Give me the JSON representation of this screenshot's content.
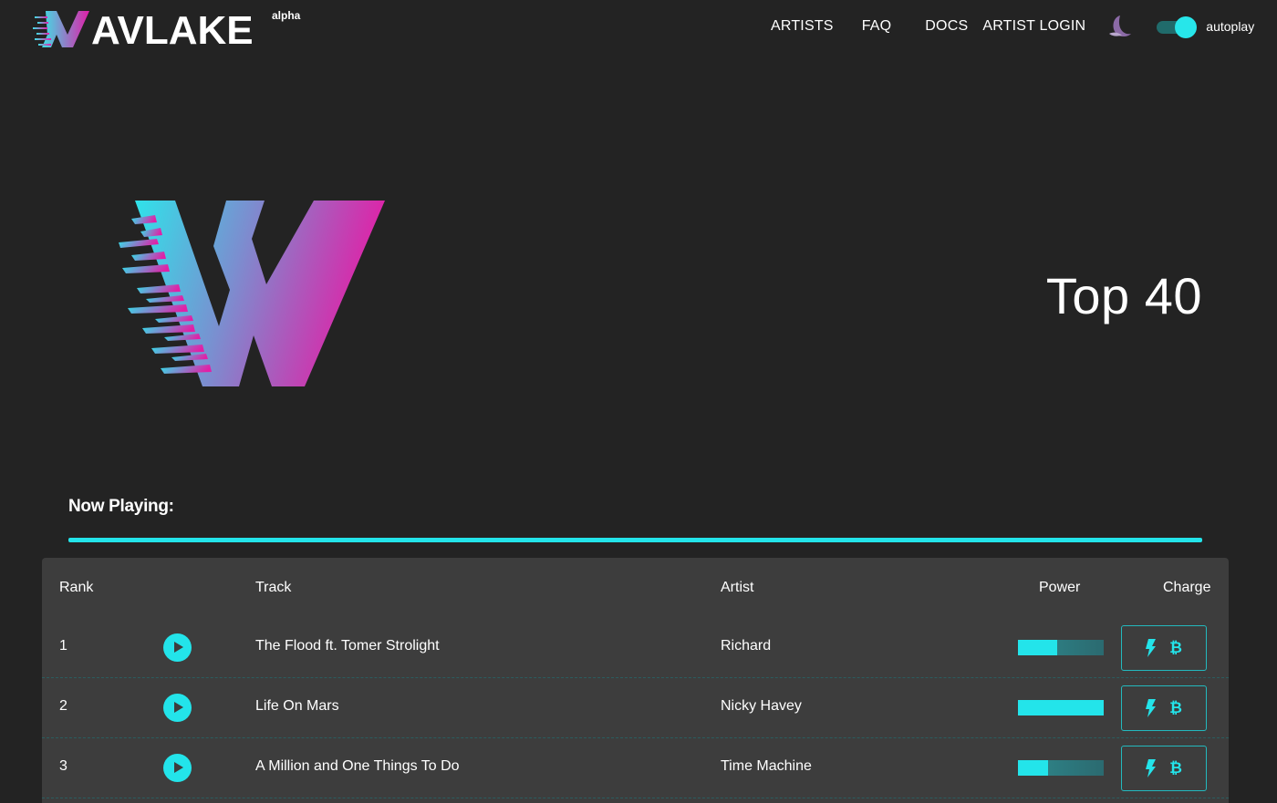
{
  "brand": {
    "logo_text": "WAVLAKE",
    "badge": "alpha",
    "gradient_start": "#3fe0e6",
    "gradient_end": "#e11ea8"
  },
  "nav": {
    "artists": "ARTISTS",
    "faq": "FAQ",
    "docs": "DOCS",
    "artist_login": "ARTIST LOGIN",
    "theme_icon": "moon-icon",
    "autoplay_label": "autoplay",
    "autoplay_on": true
  },
  "hero": {
    "title": "Top 40"
  },
  "now_playing": {
    "label": "Now Playing:",
    "accent": "#23e4ea"
  },
  "table": {
    "headers": {
      "rank": "Rank",
      "track": "Track",
      "artist": "Artist",
      "power": "Power",
      "charge": "Charge"
    },
    "rows": [
      {
        "rank": "1",
        "track": "The Flood ft. Tomer Strolight",
        "artist": "Richard",
        "power": 0.46
      },
      {
        "rank": "2",
        "track": "Life On Mars",
        "artist": "Nicky Havey",
        "power": 1.0
      },
      {
        "rank": "3",
        "track": "A Million and One Things To Do",
        "artist": "Time Machine",
        "power": 0.35
      }
    ],
    "charge_icons": [
      "lightning-icon",
      "bitcoin-icon"
    ],
    "bitcoin_symbol": "₿"
  }
}
